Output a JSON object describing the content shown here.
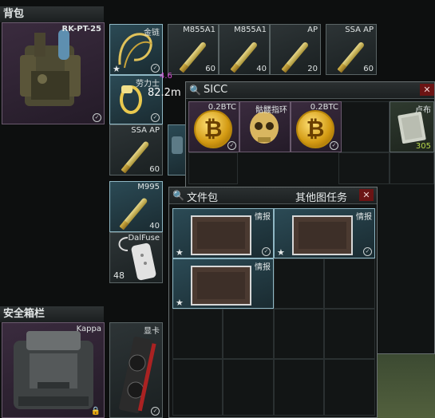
{
  "backpack": {
    "header": "背包",
    "name": "RK-PT-25"
  },
  "items": {
    "golden_chain": "金链",
    "m855a1_a": {
      "label": "M855A1",
      "count": "60"
    },
    "m855a1_b": {
      "label": "M855A1",
      "count": "40"
    },
    "ap": {
      "label": "AP",
      "count": "20"
    },
    "ssa_ap_top": {
      "label": "SSA AP",
      "count": "60"
    },
    "ring": "劳力士",
    "ssa_ap": {
      "label": "SSA AP",
      "count": "60"
    },
    "m995": {
      "label": "M995",
      "count": "40"
    },
    "dalfuse": {
      "label": "DalFuse",
      "count": "48"
    },
    "gpu": "显卡"
  },
  "overlay": {
    "stat_text": "4.6",
    "distance": "82.2m"
  },
  "sicc": {
    "title": "SICC",
    "btc1": "0.2BTC",
    "skull": "骷髅指环",
    "btc2": "0.2BTC",
    "cash_label": "卢布",
    "cash_count": "305"
  },
  "docs": {
    "title": "文件包",
    "task": "其他图任务",
    "intel_label": "情报"
  },
  "secure": {
    "header": "安全箱栏",
    "name": "Kappa"
  }
}
